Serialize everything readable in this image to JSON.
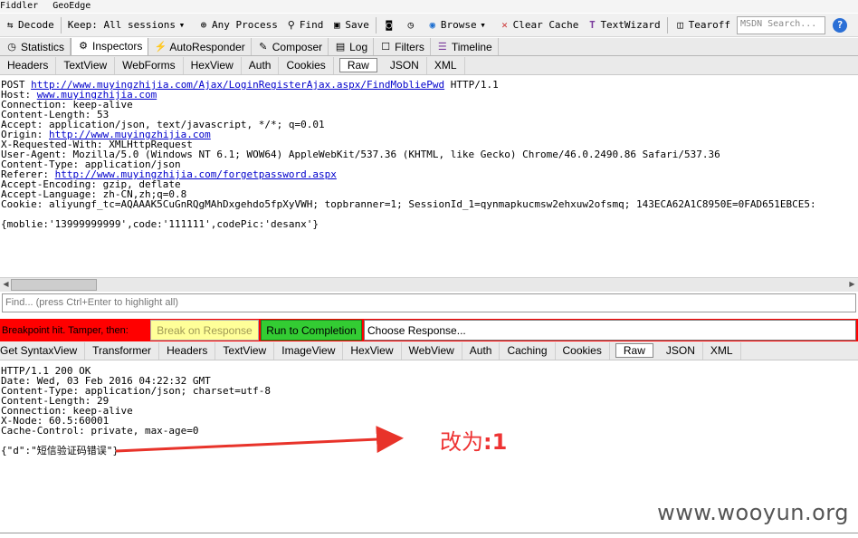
{
  "menubar": {
    "items": [
      "Fiddler",
      "GeoEdge"
    ]
  },
  "toolbar": {
    "decode": "Decode",
    "keep": "Keep: All sessions",
    "any_process": "Any Process",
    "find": "Find",
    "save": "Save",
    "browse": "Browse",
    "clear_cache": "Clear Cache",
    "textwizard": "TextWizard",
    "tearoff": "Tearoff",
    "search_placeholder": "MSDN Search..."
  },
  "main_tabs": [
    "Statistics",
    "Inspectors",
    "AutoResponder",
    "Composer",
    "Log",
    "Filters",
    "Timeline"
  ],
  "request_tabs": [
    "Headers",
    "TextView",
    "WebForms",
    "HexView",
    "Auth",
    "Cookies",
    "Raw",
    "JSON",
    "XML"
  ],
  "request": {
    "lines": [
      {
        "pre": "POST ",
        "link": "http://www.muyingzhijia.com/Ajax/LoginRegisterAjax.aspx/FindMobliePwd",
        "post": " HTTP/1.1"
      },
      {
        "pre": "Host: ",
        "link": "www.muyingzhijia.com",
        "post": ""
      },
      {
        "pre": "Connection: keep-alive",
        "link": "",
        "post": ""
      },
      {
        "pre": "Content-Length: 53",
        "link": "",
        "post": ""
      },
      {
        "pre": "Accept: application/json, text/javascript, */*; q=0.01",
        "link": "",
        "post": ""
      },
      {
        "pre": "Origin: ",
        "link": "http://www.muyingzhijia.com",
        "post": ""
      },
      {
        "pre": "X-Requested-With: XMLHttpRequest",
        "link": "",
        "post": ""
      },
      {
        "pre": "User-Agent: Mozilla/5.0 (Windows NT 6.1; WOW64) AppleWebKit/537.36 (KHTML, like Gecko) Chrome/46.0.2490.86 Safari/537.36",
        "link": "",
        "post": ""
      },
      {
        "pre": "Content-Type: application/json",
        "link": "",
        "post": ""
      },
      {
        "pre": "Referer: ",
        "link": "http://www.muyingzhijia.com/forgetpassword.aspx",
        "post": ""
      },
      {
        "pre": "Accept-Encoding: gzip, deflate",
        "link": "",
        "post": ""
      },
      {
        "pre": "Accept-Language: zh-CN,zh;q=0.8",
        "link": "",
        "post": ""
      },
      {
        "pre": "Cookie: aliyungf_tc=AQAAAK5CuGnRQgMAhDxgehdo5fpXyVWH; topbranner=1; SessionId_1=qynmapkucmsw2ehxuw2ofsmq; 143ECA62A1C8950E=0FAD651EBCE5:",
        "link": "",
        "post": ""
      },
      {
        "pre": "",
        "link": "",
        "post": ""
      },
      {
        "pre": "{moblie:'13999999999',code:'111111',codePic:'desanx'}",
        "link": "",
        "post": ""
      }
    ]
  },
  "find_placeholder": "Find... (press Ctrl+Enter to highlight all)",
  "breakpoint": {
    "text": "Breakpoint hit. Tamper, then:",
    "break_on_response": "Break on Response",
    "run_to_completion": "Run to Completion",
    "choose_response": "Choose Response..."
  },
  "response_tabs": [
    "Get SyntaxView",
    "Transformer",
    "Headers",
    "TextView",
    "ImageView",
    "HexView",
    "WebView",
    "Auth",
    "Caching",
    "Cookies",
    "Raw",
    "JSON",
    "XML"
  ],
  "response": {
    "lines": [
      "HTTP/1.1 200 OK",
      "Date: Wed, 03 Feb 2016 04:22:32 GMT",
      "Content-Type: application/json; charset=utf-8",
      "Content-Length: 29",
      "Connection: keep-alive",
      "X-Node: 60.5:60001",
      "Cache-Control: private, max-age=0",
      "",
      "{\"d\":\"短信验证码错误\"}"
    ]
  },
  "annotation": {
    "text_prefix": "改为",
    "text_value": ":1",
    "color": "#ee3333"
  },
  "watermark": "www.wooyun.org"
}
